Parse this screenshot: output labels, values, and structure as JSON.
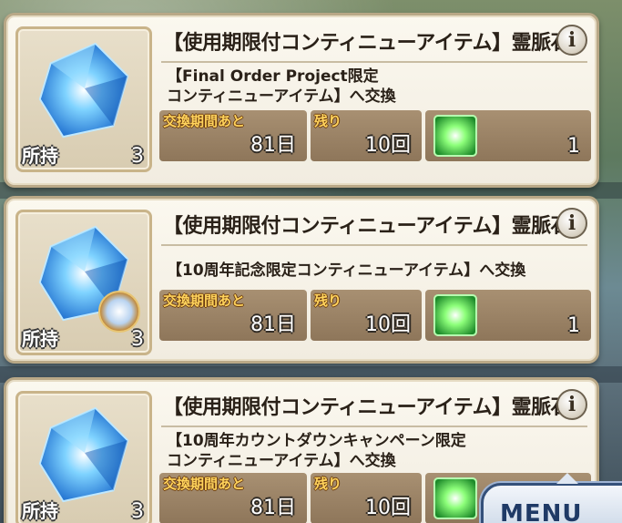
{
  "items": [
    {
      "title": "【使用期限付コンティニューアイテム】霊脈石",
      "desc_lines": [
        "【Final Order Project限定",
        "コンティニューアイテム】へ交換"
      ],
      "owned_label": "所持",
      "owned_count": "3",
      "period_label": "交換期間あと",
      "period_value": "81日",
      "remain_label": "残り",
      "remain_value": "10回",
      "cost_value": "1",
      "info": "i"
    },
    {
      "title": "【使用期限付コンティニューアイテム】霊脈石",
      "desc_lines": [
        "【10周年記念限定コンティニューアイテム】へ交換"
      ],
      "owned_label": "所持",
      "owned_count": "3",
      "period_label": "交換期間あと",
      "period_value": "81日",
      "remain_label": "残り",
      "remain_value": "10回",
      "cost_value": "1",
      "info": "i"
    },
    {
      "title": "【使用期限付コンティニューアイテム】霊脈石",
      "desc_lines": [
        "【10周年カウントダウンキャンペーン限定",
        "コンティニューアイテム】へ交換"
      ],
      "owned_label": "所持",
      "owned_count": "3",
      "period_label": "交換期間あと",
      "period_value": "81日",
      "remain_label": "残り",
      "remain_value": "10回",
      "info": "i"
    }
  ],
  "menu": {
    "label": "MENU"
  },
  "colors": {
    "accent_gold": "#ffd35c",
    "card_border": "#b9a887",
    "menu_blue": "#1f3a66"
  },
  "icons": {
    "gem": "blue-spirit-stone-icon",
    "cube": "green-cube-icon",
    "info": "info-icon",
    "badge": "anniversary-badge-icon"
  }
}
